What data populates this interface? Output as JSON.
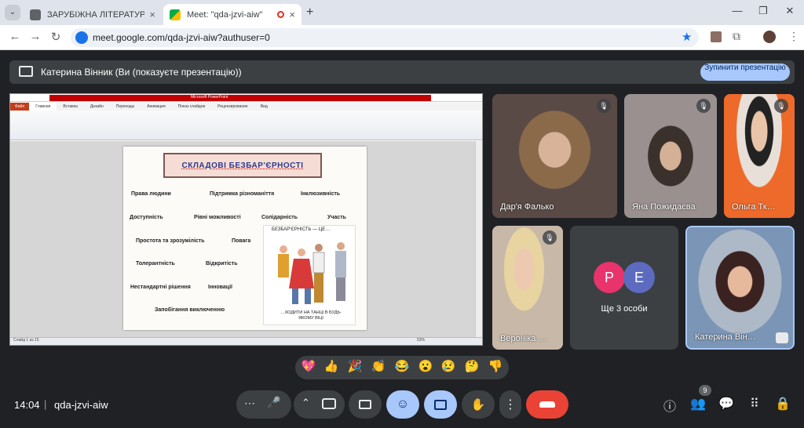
{
  "tabs": [
    {
      "title": "ЗАРУБІЖНА ЛІТЕРАТУРА Вінн…",
      "close": "×"
    },
    {
      "title": "Meet: \"qda-jzvi-aiw\"",
      "close": "×"
    }
  ],
  "browser": {
    "new_tab": "+",
    "url": "meet.google.com/qda-jzvi-aiw?authuser=0"
  },
  "presenting": {
    "text": "Катерина Вінник (Ви (показуєте презентацію))",
    "stop_label": "Зупинити презентацію"
  },
  "slide": {
    "app_title": "Microsoft PowerPoint",
    "ribbon_tabs": [
      "Файл",
      "Главная",
      "Вставка",
      "Дизайн",
      "Переходы",
      "Анимация",
      "Показ слайдов",
      "Рецензирование",
      "Вид"
    ],
    "title": "СКЛАДОВІ БЕЗБАР'ЄРНОСТІ",
    "terms": [
      "Права людини",
      "Підтримка різноманіття",
      "Інклюзивність",
      "Доступність",
      "Рівні можливості",
      "Солідарність",
      "Участь",
      "Простота та зрозумілість",
      "Повага",
      "Толерантність",
      "Відкритість",
      "Нестандартні рішення",
      "Інновації",
      "Запобігання виключенню"
    ],
    "picture_caption_top": "БЕЗБАР'ЄРНІСТЬ — ЦЕ…",
    "picture_caption_bottom": "…ХОДИТИ НА ТАНЦІ В БУДЬ-ЯКОМУ ВІЦІ",
    "status": "Слайд 1 из 15",
    "zoom": "53%"
  },
  "participants": [
    {
      "name": "Дар'я Фалько",
      "bg": "#6b5a55"
    },
    {
      "name": "Яна Пожидаєва",
      "bg": "#8a7f7c"
    },
    {
      "name": "Ольга Тк…",
      "bg": "#e06030"
    },
    {
      "name": "Вероніка …",
      "bg": "#b8a898"
    },
    {
      "name": "Катерина Він…",
      "bg": "#7a95b5"
    }
  ],
  "others": {
    "avatars": [
      "P",
      "E"
    ],
    "label": "Ще 3 особи"
  },
  "reactions": [
    "💖",
    "👍",
    "🎉",
    "👏",
    "😂",
    "😮",
    "😢",
    "🤔",
    "👎"
  ],
  "footer": {
    "time": "14:04",
    "separator": "|",
    "code": "qda-jzvi-aiw",
    "people_count": "9"
  },
  "colors": {
    "stop": "#a8c7fa",
    "end_call": "#ea4335",
    "active_btn": "#a8c7fa",
    "avatar_p": "#e8336d",
    "avatar_e": "#5c6bc0"
  }
}
